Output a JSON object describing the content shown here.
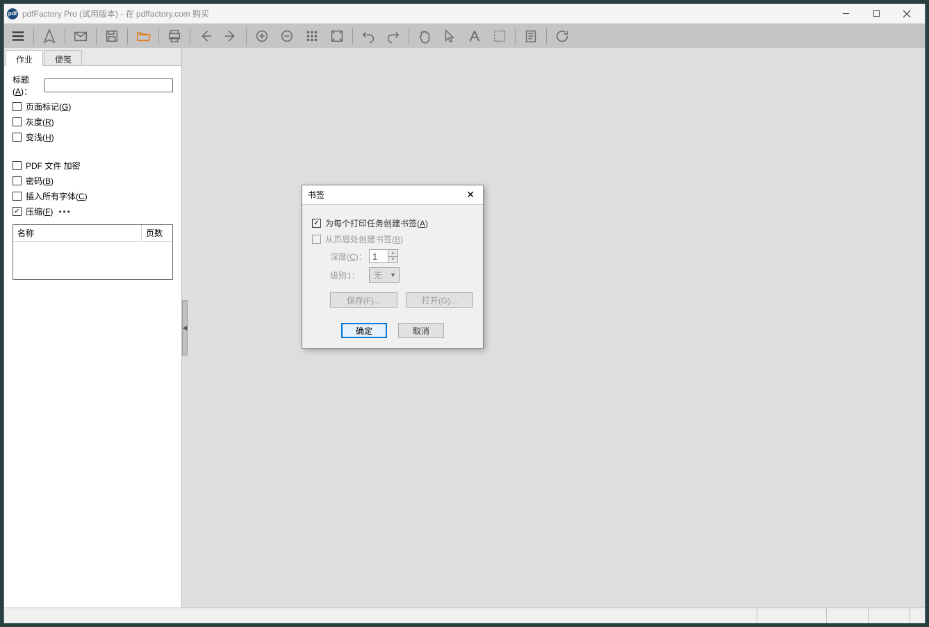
{
  "titlebar": {
    "app_icon_text": "pdf",
    "title": "pdfFactory Pro (试用版本) - 在 pdffactory.com 购买"
  },
  "tabs": {
    "job": "作业",
    "note": "便笺"
  },
  "panel": {
    "title_label": "标题(A)：",
    "title_value": "",
    "page_mark": "页面标记(G)",
    "grayscale": "灰度(R)",
    "fade": "变浅(H)",
    "pdf_encrypt": "PDF 文件 加密",
    "password": "密码(B)",
    "embed_fonts": "插入所有字体(C)",
    "compress": "压缩(F)"
  },
  "list": {
    "col_name": "名称",
    "col_pages": "页数"
  },
  "dialog": {
    "title": "书签",
    "opt_per_job": "为每个打印任务创建书签(A)",
    "opt_from_header": "从页眉处创建书签(B)",
    "depth_label": "深度(C)：",
    "depth_value": "1",
    "level_label": "级别1：",
    "level_value": "无",
    "save_btn": "保存(F)...",
    "open_btn": "打开(G)...",
    "ok": "确定",
    "cancel": "取消"
  }
}
